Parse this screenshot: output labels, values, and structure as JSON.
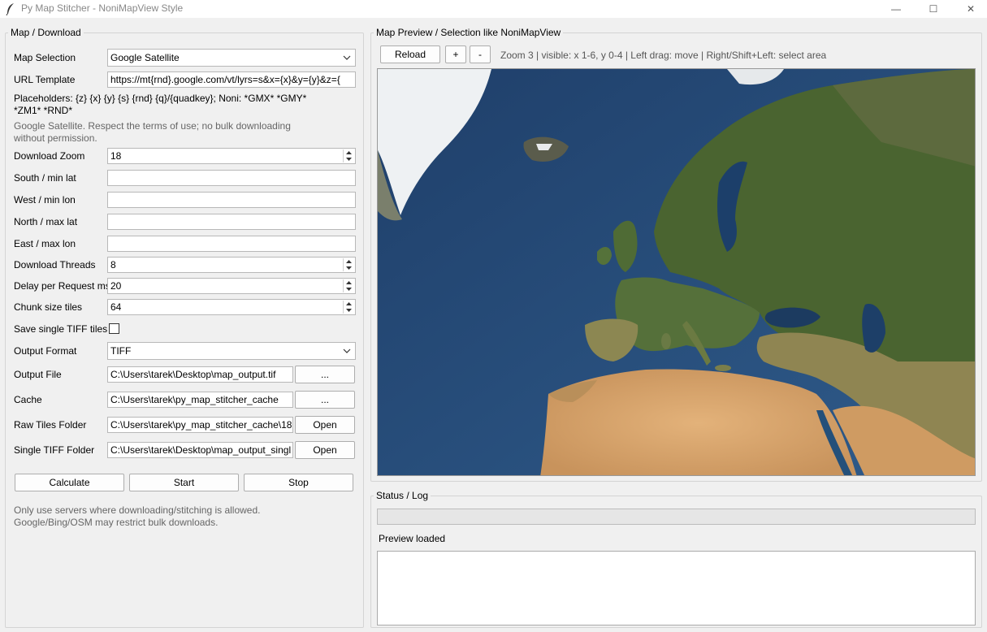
{
  "window": {
    "title": "Py Map Stitcher - NoniMapView Style",
    "min_glyph": "—",
    "max_glyph": "☐",
    "close_glyph": "✕"
  },
  "left_panel": {
    "title": "Map / Download",
    "map_selection": {
      "label": "Map Selection",
      "value": "Google Satellite"
    },
    "url_template": {
      "label": "URL Template",
      "value": "https://mt{rnd}.google.com/vt/lyrs=s&x={x}&y={y}&z={"
    },
    "placeholders_text": "Placeholders: {z} {x} {y} {s} {rnd} {q}/{quadkey}; Noni: *GMX* *GMY* *ZM1* *RND*",
    "terms_note": "Google Satellite. Respect the terms of use; no bulk downloading without permission.",
    "download_zoom": {
      "label": "Download Zoom",
      "value": "18"
    },
    "south": {
      "label": "South / min lat",
      "value": ""
    },
    "west": {
      "label": "West / min lon",
      "value": ""
    },
    "north": {
      "label": "North / max lat",
      "value": ""
    },
    "east": {
      "label": "East / max lon",
      "value": ""
    },
    "threads": {
      "label": "Download Threads",
      "value": "8"
    },
    "delay": {
      "label": "Delay per Request ms",
      "value": "20"
    },
    "chunk": {
      "label": "Chunk size tiles",
      "value": "64"
    },
    "save_single_tiff": {
      "label": "Save single TIFF tiles",
      "checked": false
    },
    "output_format": {
      "label": "Output Format",
      "value": "TIFF"
    },
    "output_file": {
      "label": "Output File",
      "value": "C:\\Users\\tarek\\Desktop\\map_output.tif",
      "button": "..."
    },
    "cache": {
      "label": "Cache",
      "value": "C:\\Users\\tarek\\py_map_stitcher_cache",
      "button": "..."
    },
    "raw_tiles": {
      "label": "Raw Tiles Folder",
      "value": "C:\\Users\\tarek\\py_map_stitcher_cache\\18",
      "button": "Open"
    },
    "single_tiff": {
      "label": "Single TIFF Folder",
      "value": "C:\\Users\\tarek\\Desktop\\map_output_singl",
      "button": "Open"
    },
    "buttons": {
      "calculate": "Calculate",
      "start": "Start",
      "stop": "Stop"
    },
    "footer_note": "Only use servers where downloading/stitching is allowed. Google/Bing/OSM may restrict bulk downloads."
  },
  "preview_panel": {
    "title": "Map Preview / Selection like NoniMapView",
    "reload": "Reload",
    "zoom_in": "+",
    "zoom_out": "-",
    "info": "Zoom 3 | visible: x 1-6, y 0-4 | Left drag: move | Right/Shift+Left: select area"
  },
  "status_panel": {
    "title": "Status / Log",
    "progress": 0,
    "status_text": "Preview loaded",
    "log_text": ""
  },
  "colors": {
    "ocean": "#2a4f7d",
    "land_green": "#4b6a32",
    "desert": "#d8a86f",
    "ice": "#f2f4f6"
  }
}
